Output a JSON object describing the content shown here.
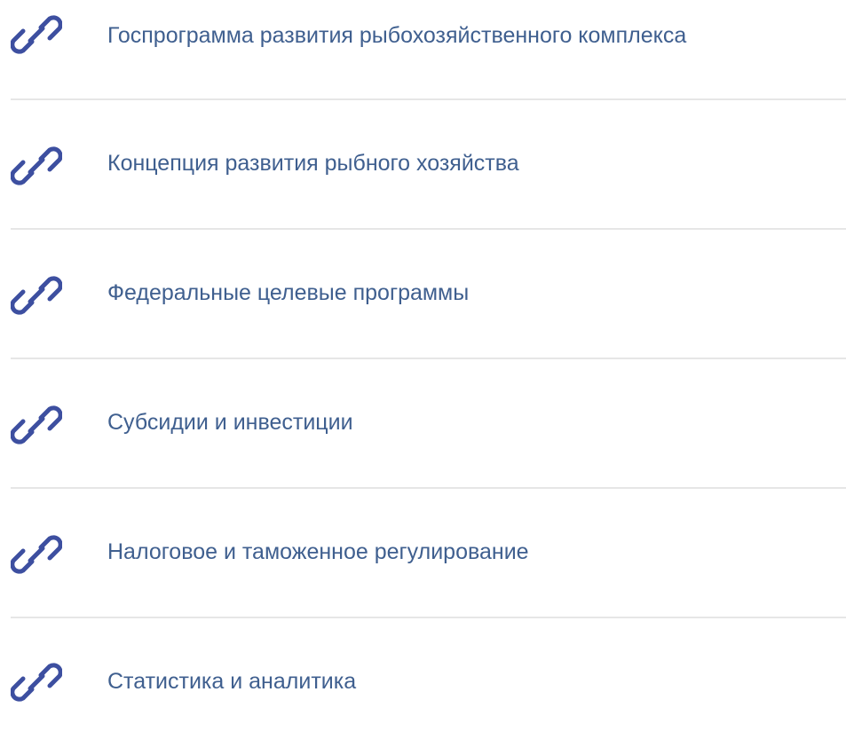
{
  "colors": {
    "icon": "#3d4fa0",
    "label": "#3f5f8f",
    "divider": "#e6e6e6"
  },
  "links": [
    {
      "label": "Госпрограмма развития рыбохозяйственного комплекса",
      "icon": "link-icon"
    },
    {
      "label": "Концепция развития рыбного хозяйства",
      "icon": "link-icon"
    },
    {
      "label": "Федеральные целевые программы",
      "icon": "link-icon"
    },
    {
      "label": "Субсидии и инвестиции",
      "icon": "link-icon"
    },
    {
      "label": "Налоговое и таможенное регулирование",
      "icon": "link-icon"
    },
    {
      "label": "Статистика и аналитика",
      "icon": "link-icon"
    }
  ]
}
